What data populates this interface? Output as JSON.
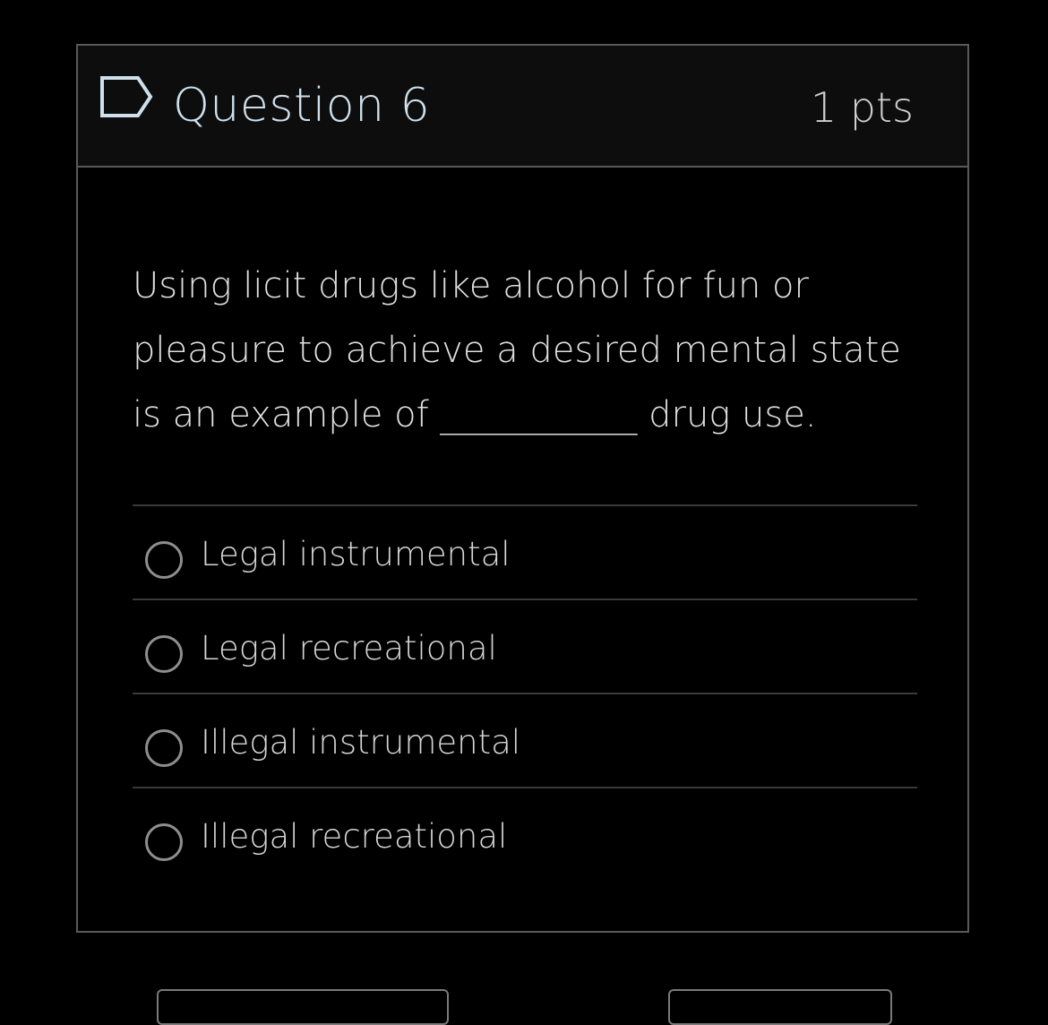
{
  "question": {
    "title": "Question 6",
    "points": "1 pts",
    "flag_icon": "flag-bookmark-icon",
    "text": "Using licit drugs like alcohol for fun or pleasure to achieve a desired mental state is an example of ___________ drug use."
  },
  "answers": [
    {
      "label": "Legal instrumental",
      "selected": false
    },
    {
      "label": "Legal recreational",
      "selected": false
    },
    {
      "label": "Illegal instrumental",
      "selected": false
    },
    {
      "label": "Illegal recreational",
      "selected": false
    }
  ],
  "colors": {
    "background": "#000000",
    "header_background": "#0d0d0d",
    "border": "#5a5a5a",
    "title_text": "#cfe0ec",
    "body_text": "#e0e0e0",
    "radio_border": "#8e8e8e"
  }
}
